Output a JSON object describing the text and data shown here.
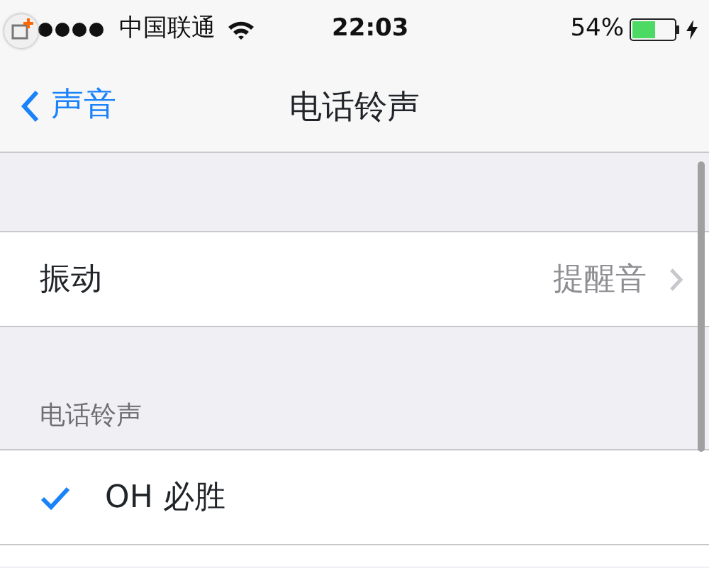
{
  "status_bar": {
    "carrier": "中国联通",
    "time": "22:03",
    "battery": "54%"
  },
  "nav_bar": {
    "back": "声音",
    "title": "电话铃声"
  },
  "vibration_row": {
    "label": "振动",
    "value": "提醒音"
  },
  "ringtones": {
    "header": "电话铃声",
    "items": [
      {
        "label": "OH 必胜",
        "selected": true
      }
    ]
  }
}
